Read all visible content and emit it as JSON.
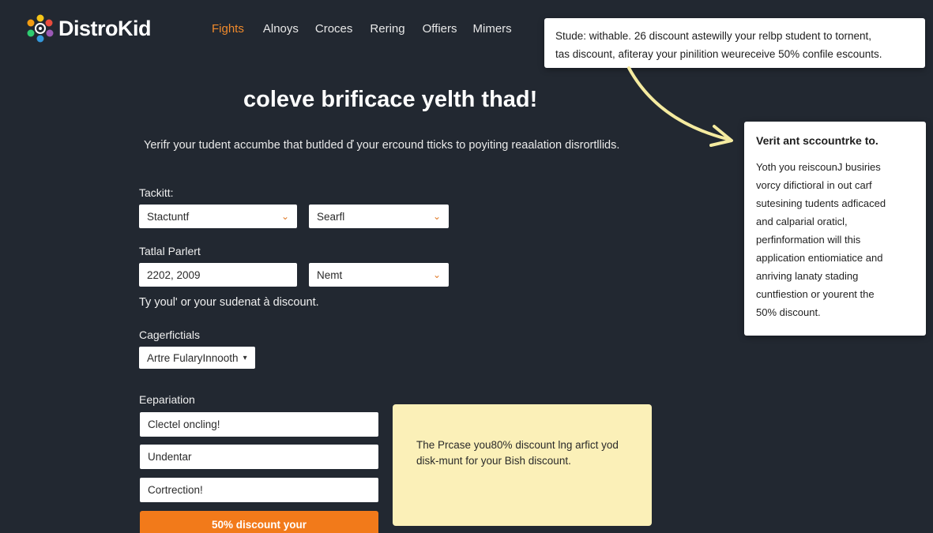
{
  "brand": {
    "name": "DistroKid",
    "logo_icon": "multicolor-flower-logo"
  },
  "nav": {
    "items": [
      {
        "label": "Fights",
        "active": true
      },
      {
        "label": "Alnoys",
        "active": false
      },
      {
        "label": "Croces",
        "active": false
      },
      {
        "label": "Rering",
        "active": false
      },
      {
        "label": "Offiers",
        "active": false
      },
      {
        "label": "Mimers",
        "active": false
      }
    ]
  },
  "callout_top": {
    "line1": "Stude: withable. 26 discount astewilly your relbp student to tornent,",
    "line2": "tas discount, afiteray your pinilition weureceive 50% confile escounts."
  },
  "callout_right": {
    "title": "Verit ant sccountrke to.",
    "lines": [
      "Yoth you reiscounJ busiries",
      "vorcy difictioral in out carf",
      "sutesining tudents adficaced",
      "and calparial oraticl,",
      "perfinformation will this",
      "application entiomiatice and",
      "anriving lanaty stading",
      "cuntfiestion or yourent the",
      "50% discount."
    ]
  },
  "hero": {
    "title": "coleve brificace yelth thad!",
    "description": "Yerifr your tudent accumbe that butlded ď your ercound tticks to poyiting reaalation disrortllids."
  },
  "form": {
    "section1_label": "Tackitt:",
    "select_a": "Stactuntf",
    "select_b": "Searfl",
    "section2_label": "Tatlal Parlert",
    "date_value": "2202, 2009",
    "select_c": "Nemt",
    "note": "Ty youl' or your sudenat à discount.",
    "section3_label": "Cagerfictials",
    "dropdown_value": "Artre FularyInnooth",
    "section4_label": "Eepariation",
    "input1": "Clectel oncling!",
    "input2": "Undentar",
    "input3": "Cortrection!"
  },
  "info_box": {
    "line1": "The Prcase you80% discount lng arfict yod",
    "line2": "disk-munt for your Bish discount."
  },
  "cta": {
    "label": "50% discount your"
  },
  "colors": {
    "background": "#222831",
    "accent": "#f08a2c",
    "button": "#f27a1a",
    "note_bg": "#fbf0b8",
    "arrow": "#f5eba0"
  }
}
